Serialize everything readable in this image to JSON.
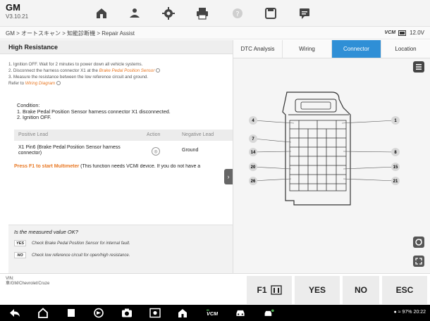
{
  "header": {
    "make": "GM",
    "version": "V3.10.21",
    "icons": [
      "home-icon",
      "vehicle-service-icon",
      "settings-icon",
      "print-icon",
      "help-icon",
      "save-icon",
      "message-icon"
    ]
  },
  "breadcrumb": "GM > オートスキャン > 知能診断機 > Repair Assist",
  "status": {
    "vcm": "VCM",
    "voltage": "12.0V"
  },
  "panel_title": "High Resistance",
  "steps": {
    "s1": "1. Ignition OFF. Wait for 2 minutes to power down all vehicle systems.",
    "s2_prefix": "2. Disconnect the harness connector X1 at the ",
    "s2_link": "Brake Pedal Position Sensor",
    "s3_line1": "3. Measure the resistance between the low reference circuit and ground.",
    "s3_prefix": "Refer to ",
    "s3_link": "Wiring Diagram"
  },
  "condition": {
    "title": "Condition:",
    "line1": "1. Brake Pedal Position Sensor harness connector X1 disconnected.",
    "line2": "2. Ignition OFF."
  },
  "table": {
    "headers": {
      "positive": "Positive Lead",
      "action": "Action",
      "negative": "Negative Lead"
    },
    "row": {
      "positive": "X1 Pin6 (Brake Pedal Position Sensor harness connector)",
      "negative": "Ground"
    }
  },
  "multimeter": {
    "highlight": "Press F1 to start Multimeter",
    "rest": " (This function needs VCMI device. If you do not have a"
  },
  "question": {
    "title": "Is the measured value OK?",
    "yes_label": "YES",
    "yes_text": "Check Brake Pedal Position Sensor for internal fault.",
    "no_label": "NO",
    "no_text": "Check low reference circuit for open/high resistance."
  },
  "tabs": [
    {
      "label": "DTC Analysis",
      "active": false
    },
    {
      "label": "Wiring",
      "active": false
    },
    {
      "label": "Connector",
      "active": true
    },
    {
      "label": "Location",
      "active": false
    }
  ],
  "pins": [
    "4",
    "1",
    "7",
    "14",
    "8",
    "20",
    "15",
    "26",
    "21"
  ],
  "vehicle": {
    "vin_label": "VIN:",
    "path": "車/GM/Chevrolet/Cruze"
  },
  "buttons": {
    "f1": "F1",
    "yes": "YES",
    "no": "NO",
    "esc": "ESC"
  },
  "system_status": {
    "battery": "97%",
    "time": "20:22"
  },
  "colors": {
    "accent": "#2f8fd6",
    "link": "#e87722",
    "navbar": "#000000"
  }
}
